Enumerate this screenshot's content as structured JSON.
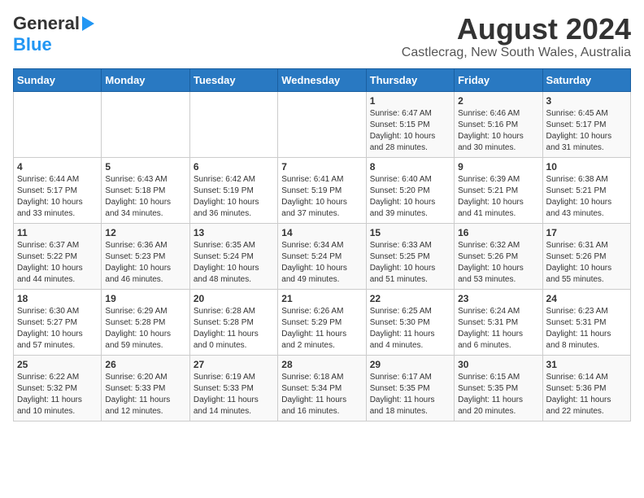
{
  "header": {
    "logo_line1": "General",
    "logo_line2": "Blue",
    "main_title": "August 2024",
    "subtitle": "Castlecrag, New South Wales, Australia"
  },
  "weekdays": [
    "Sunday",
    "Monday",
    "Tuesday",
    "Wednesday",
    "Thursday",
    "Friday",
    "Saturday"
  ],
  "weeks": [
    [
      {
        "day": "",
        "info": ""
      },
      {
        "day": "",
        "info": ""
      },
      {
        "day": "",
        "info": ""
      },
      {
        "day": "",
        "info": ""
      },
      {
        "day": "1",
        "info": "Sunrise: 6:47 AM\nSunset: 5:15 PM\nDaylight: 10 hours\nand 28 minutes."
      },
      {
        "day": "2",
        "info": "Sunrise: 6:46 AM\nSunset: 5:16 PM\nDaylight: 10 hours\nand 30 minutes."
      },
      {
        "day": "3",
        "info": "Sunrise: 6:45 AM\nSunset: 5:17 PM\nDaylight: 10 hours\nand 31 minutes."
      }
    ],
    [
      {
        "day": "4",
        "info": "Sunrise: 6:44 AM\nSunset: 5:17 PM\nDaylight: 10 hours\nand 33 minutes."
      },
      {
        "day": "5",
        "info": "Sunrise: 6:43 AM\nSunset: 5:18 PM\nDaylight: 10 hours\nand 34 minutes."
      },
      {
        "day": "6",
        "info": "Sunrise: 6:42 AM\nSunset: 5:19 PM\nDaylight: 10 hours\nand 36 minutes."
      },
      {
        "day": "7",
        "info": "Sunrise: 6:41 AM\nSunset: 5:19 PM\nDaylight: 10 hours\nand 37 minutes."
      },
      {
        "day": "8",
        "info": "Sunrise: 6:40 AM\nSunset: 5:20 PM\nDaylight: 10 hours\nand 39 minutes."
      },
      {
        "day": "9",
        "info": "Sunrise: 6:39 AM\nSunset: 5:21 PM\nDaylight: 10 hours\nand 41 minutes."
      },
      {
        "day": "10",
        "info": "Sunrise: 6:38 AM\nSunset: 5:21 PM\nDaylight: 10 hours\nand 43 minutes."
      }
    ],
    [
      {
        "day": "11",
        "info": "Sunrise: 6:37 AM\nSunset: 5:22 PM\nDaylight: 10 hours\nand 44 minutes."
      },
      {
        "day": "12",
        "info": "Sunrise: 6:36 AM\nSunset: 5:23 PM\nDaylight: 10 hours\nand 46 minutes."
      },
      {
        "day": "13",
        "info": "Sunrise: 6:35 AM\nSunset: 5:24 PM\nDaylight: 10 hours\nand 48 minutes."
      },
      {
        "day": "14",
        "info": "Sunrise: 6:34 AM\nSunset: 5:24 PM\nDaylight: 10 hours\nand 49 minutes."
      },
      {
        "day": "15",
        "info": "Sunrise: 6:33 AM\nSunset: 5:25 PM\nDaylight: 10 hours\nand 51 minutes."
      },
      {
        "day": "16",
        "info": "Sunrise: 6:32 AM\nSunset: 5:26 PM\nDaylight: 10 hours\nand 53 minutes."
      },
      {
        "day": "17",
        "info": "Sunrise: 6:31 AM\nSunset: 5:26 PM\nDaylight: 10 hours\nand 55 minutes."
      }
    ],
    [
      {
        "day": "18",
        "info": "Sunrise: 6:30 AM\nSunset: 5:27 PM\nDaylight: 10 hours\nand 57 minutes."
      },
      {
        "day": "19",
        "info": "Sunrise: 6:29 AM\nSunset: 5:28 PM\nDaylight: 10 hours\nand 59 minutes."
      },
      {
        "day": "20",
        "info": "Sunrise: 6:28 AM\nSunset: 5:28 PM\nDaylight: 11 hours\nand 0 minutes."
      },
      {
        "day": "21",
        "info": "Sunrise: 6:26 AM\nSunset: 5:29 PM\nDaylight: 11 hours\nand 2 minutes."
      },
      {
        "day": "22",
        "info": "Sunrise: 6:25 AM\nSunset: 5:30 PM\nDaylight: 11 hours\nand 4 minutes."
      },
      {
        "day": "23",
        "info": "Sunrise: 6:24 AM\nSunset: 5:31 PM\nDaylight: 11 hours\nand 6 minutes."
      },
      {
        "day": "24",
        "info": "Sunrise: 6:23 AM\nSunset: 5:31 PM\nDaylight: 11 hours\nand 8 minutes."
      }
    ],
    [
      {
        "day": "25",
        "info": "Sunrise: 6:22 AM\nSunset: 5:32 PM\nDaylight: 11 hours\nand 10 minutes."
      },
      {
        "day": "26",
        "info": "Sunrise: 6:20 AM\nSunset: 5:33 PM\nDaylight: 11 hours\nand 12 minutes."
      },
      {
        "day": "27",
        "info": "Sunrise: 6:19 AM\nSunset: 5:33 PM\nDaylight: 11 hours\nand 14 minutes."
      },
      {
        "day": "28",
        "info": "Sunrise: 6:18 AM\nSunset: 5:34 PM\nDaylight: 11 hours\nand 16 minutes."
      },
      {
        "day": "29",
        "info": "Sunrise: 6:17 AM\nSunset: 5:35 PM\nDaylight: 11 hours\nand 18 minutes."
      },
      {
        "day": "30",
        "info": "Sunrise: 6:15 AM\nSunset: 5:35 PM\nDaylight: 11 hours\nand 20 minutes."
      },
      {
        "day": "31",
        "info": "Sunrise: 6:14 AM\nSunset: 5:36 PM\nDaylight: 11 hours\nand 22 minutes."
      }
    ]
  ]
}
